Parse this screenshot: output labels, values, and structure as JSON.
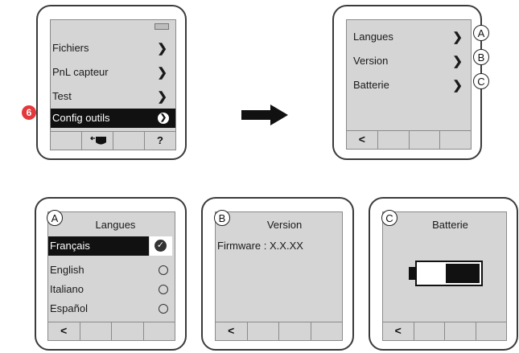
{
  "step_number": "6",
  "colors": {
    "badge": "#e4393c",
    "screen": "#d5d5d5",
    "selected": "#111111"
  },
  "main_menu": {
    "items": [
      {
        "label": "Fichiers"
      },
      {
        "label": "PnL capteur"
      },
      {
        "label": "Test"
      },
      {
        "label": "Config outils"
      }
    ],
    "help_key": "?"
  },
  "config_menu": {
    "items": [
      {
        "label": "Langues",
        "marker": "A"
      },
      {
        "label": "Version",
        "marker": "B"
      },
      {
        "label": "Batterie",
        "marker": "C"
      }
    ],
    "back_key": "<"
  },
  "langues_panel": {
    "marker": "A",
    "title": "Langues",
    "options": [
      {
        "label": "Français",
        "selected": true
      },
      {
        "label": "English",
        "selected": false
      },
      {
        "label": "Italiano",
        "selected": false
      },
      {
        "label": "Español",
        "selected": false
      }
    ],
    "back_key": "<"
  },
  "version_panel": {
    "marker": "B",
    "title": "Version",
    "firmware_text": "Firmware : X.X.XX",
    "back_key": "<"
  },
  "batterie_panel": {
    "marker": "C",
    "title": "Batterie",
    "battery_level": 0.55,
    "back_key": "<"
  }
}
